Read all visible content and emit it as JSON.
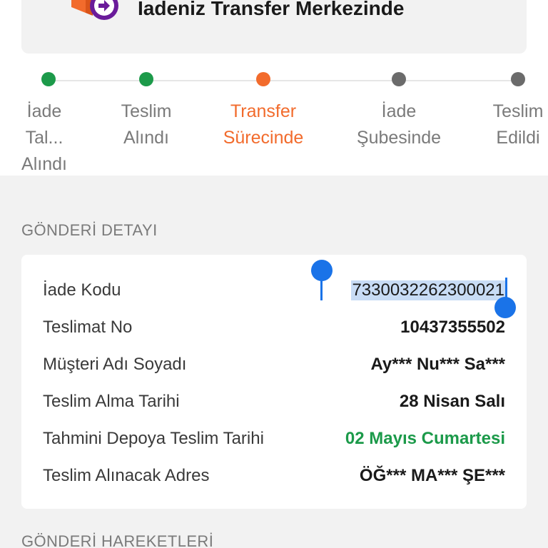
{
  "header": {
    "title": "İadeniz Transfer Merkezinde",
    "icon": "box-arrow-icon",
    "icon_colors": {
      "box": "#f26b2c",
      "badge": "#6a1b9a"
    }
  },
  "stepper": {
    "steps": [
      {
        "label_lines": [
          "İade",
          "Tal...",
          "Alındı"
        ],
        "state": "done"
      },
      {
        "label_lines": [
          "Teslim",
          "Alındı"
        ],
        "state": "done"
      },
      {
        "label_lines": [
          "Transfer",
          "Sürecinde"
        ],
        "state": "active"
      },
      {
        "label_lines": [
          "İade",
          "Şubesinde"
        ],
        "state": "pending"
      },
      {
        "label_lines": [
          "Teslim",
          "Edildi"
        ],
        "state": "pending"
      }
    ],
    "colors": {
      "done": "#1c9a4a",
      "active": "#f26b2c",
      "pending": "#6b6b6b"
    }
  },
  "shipment_detail": {
    "section_title": "GÖNDERİ DETAYI",
    "rows": [
      {
        "label": "İade Kodu",
        "value": "7330032262300021",
        "selected": true
      },
      {
        "label": "Teslimat No",
        "value": "10437355502"
      },
      {
        "label": "Müşteri Adı Soyadı",
        "value": "Ay*** Nu*** Sa***"
      },
      {
        "label": "Teslim Alma Tarihi",
        "value": "28 Nisan Salı"
      },
      {
        "label": "Tahmini Depoya Teslim Tarihi",
        "value": "02 Mayıs Cumartesi",
        "highlight": "green"
      },
      {
        "label": "Teslim Alınacak Adres",
        "value": "ÖĞ*** MA*** ŞE***"
      }
    ]
  },
  "movements": {
    "section_title": "GÖNDERİ HAREKETLERİ"
  }
}
